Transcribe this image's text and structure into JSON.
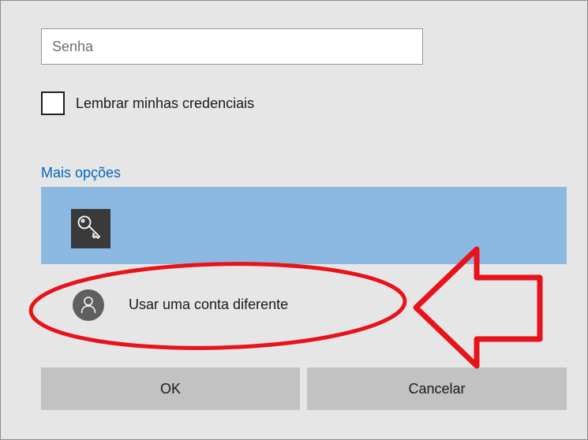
{
  "password": {
    "placeholder": "Senha",
    "value": ""
  },
  "remember": {
    "label": "Lembrar minhas credenciais",
    "checked": false
  },
  "more_options": {
    "label": "Mais opções"
  },
  "options": [
    {
      "icon": "key-icon",
      "selected": true
    },
    {
      "icon": "person-icon",
      "label": "Usar uma conta diferente"
    }
  ],
  "buttons": {
    "ok": "OK",
    "cancel": "Cancelar"
  },
  "colors": {
    "dialog_bg": "#e6e6e6",
    "link": "#0067c0",
    "selected_bg": "#8cb9e1",
    "button_bg": "#c2c2c2",
    "annotation": "#e8131a"
  },
  "annotations": [
    {
      "shape": "ellipse",
      "icon": "highlight-ellipse-icon"
    },
    {
      "shape": "arrow-left",
      "icon": "left-arrow-icon"
    }
  ]
}
